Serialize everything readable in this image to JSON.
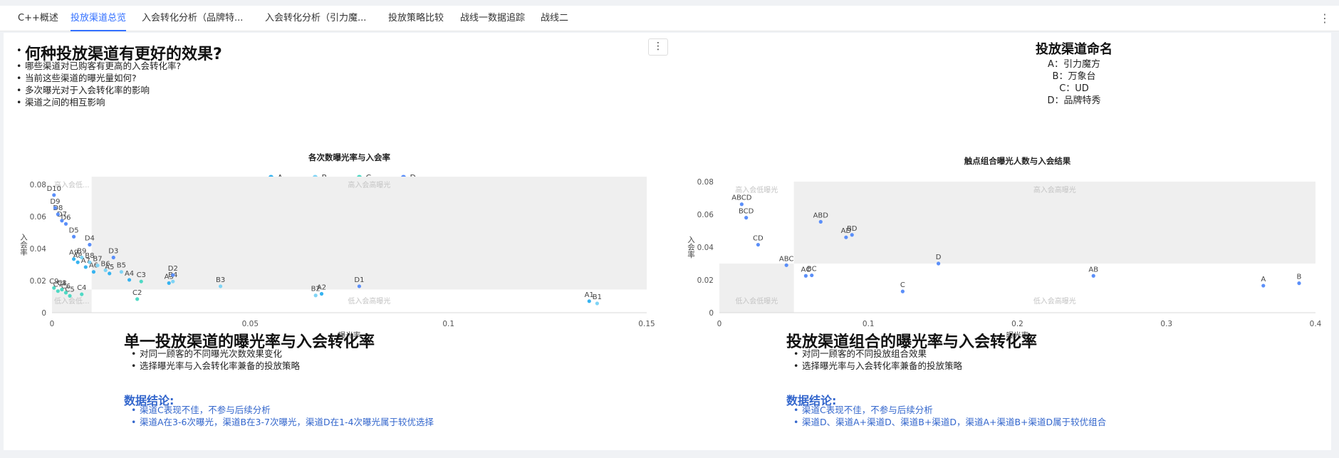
{
  "tabs": [
    {
      "label": "C++概述",
      "active": false
    },
    {
      "label": "投放渠道总览",
      "active": true
    },
    {
      "label": "入会转化分析（品牌特...",
      "active": false
    },
    {
      "label": "入会转化分析（引力魔...",
      "active": false
    },
    {
      "label": "投放策略比较",
      "active": false
    },
    {
      "label": "战线一数据追踪",
      "active": false
    },
    {
      "label": "战线二",
      "active": false
    }
  ],
  "intro": {
    "title": "何种投放渠道有更好的效果?",
    "bullets": [
      "哪些渠道对已购客有更高的入会转化率?",
      "当前这些渠道的曝光量如何?",
      "多次曝光对于入会转化率的影响",
      "渠道之间的相互影响"
    ]
  },
  "naming": {
    "title": "投放渠道命名",
    "lines": [
      "A：引力魔方",
      "B：万象台",
      "C：UD",
      "D：品牌特秀"
    ]
  },
  "left_section": {
    "title": "单一投放渠道的曝光率与入会转化率",
    "bullets": [
      "对同一顾客的不同曝光次数效果变化",
      "选择曝光率与入会转化率兼备的投放策略"
    ],
    "conclusion_title": "数据结论:",
    "conclusions": [
      "渠道C表现不佳，不参与后续分析",
      "渠道A在3-6次曝光，渠道B在3-7次曝光，渠道D在1-4次曝光属于较优选择"
    ]
  },
  "right_section": {
    "title": "投放渠道组合的曝光率与入会转化率",
    "bullets": [
      "对同一顾客的不同投放组合效果",
      "选择曝光率与入会转化率兼备的投放策略"
    ],
    "conclusion_title": "数据结论:",
    "conclusions": [
      "渠道C表现不佳，不参与后续分析",
      "渠道D、渠道A+渠道D、渠道B+渠道D，渠道A+渠道B+渠道D属于较优组合"
    ]
  },
  "colors": {
    "A": "#36b3f0",
    "B": "#7fd4f5",
    "C": "#4fd9c4",
    "D": "#5b8ff9",
    "accent": "#3370ff"
  },
  "chart_data": [
    {
      "type": "scatter",
      "title": "各次数曝光率与入会率",
      "xlabel": "曝光率",
      "ylabel": "入会率",
      "xlim": [
        0,
        0.15
      ],
      "ylim": [
        0,
        0.085
      ],
      "xticks": [
        0,
        0.05,
        0.1,
        0.15
      ],
      "xtick_labels": [
        "0",
        "0.05",
        "0.1",
        "0.15"
      ],
      "yticks": [
        0,
        0.02,
        0.04,
        0.06,
        0.08
      ],
      "ytick_labels": [
        "0",
        "0.02",
        "0.04",
        "0.06",
        "0.08"
      ],
      "legend": [
        "A",
        "B",
        "C",
        "D"
      ],
      "legend_position": "top-center",
      "quadrant": {
        "x_split": 0.01,
        "y_split": 0.0145,
        "labels": {
          "high_low": "高入会低...",
          "high_high": "高入会高曝光",
          "low_low": "低入会低...",
          "low_high": "低入会高曝光"
        }
      },
      "series": [
        {
          "name": "A",
          "points": [
            {
              "label": "A1",
              "x": 0.1355,
              "y": 0.0072
            },
            {
              "label": "A2",
              "x": 0.068,
              "y": 0.0118
            },
            {
              "label": "A3",
              "x": 0.0295,
              "y": 0.0185
            },
            {
              "label": "A4",
              "x": 0.0195,
              "y": 0.0205
            },
            {
              "label": "A5",
              "x": 0.0145,
              "y": 0.0245
            },
            {
              "label": "A6",
              "x": 0.0105,
              "y": 0.0255
            },
            {
              "label": "A7",
              "x": 0.0085,
              "y": 0.0285
            },
            {
              "label": "A8",
              "x": 0.0065,
              "y": 0.0315
            },
            {
              "label": "A9",
              "x": 0.0055,
              "y": 0.0335
            }
          ]
        },
        {
          "name": "B",
          "points": [
            {
              "label": "B1",
              "x": 0.1375,
              "y": 0.0058
            },
            {
              "label": "B2",
              "x": 0.0665,
              "y": 0.0108
            },
            {
              "label": "B3",
              "x": 0.0425,
              "y": 0.0165
            },
            {
              "label": "B4",
              "x": 0.0305,
              "y": 0.0195
            },
            {
              "label": "B5",
              "x": 0.0175,
              "y": 0.0255
            },
            {
              "label": "B6",
              "x": 0.0135,
              "y": 0.0265
            },
            {
              "label": "B7",
              "x": 0.0115,
              "y": 0.0295
            },
            {
              "label": "B8",
              "x": 0.0095,
              "y": 0.0315
            },
            {
              "label": "B9",
              "x": 0.0075,
              "y": 0.0345
            }
          ]
        },
        {
          "name": "C",
          "points": [
            {
              "label": "C1",
              "x": 0.0025,
              "y": 0.0145
            },
            {
              "label": "C2",
              "x": 0.0215,
              "y": 0.0085
            },
            {
              "label": "C3",
              "x": 0.0225,
              "y": 0.0195
            },
            {
              "label": "C4",
              "x": 0.0075,
              "y": 0.0115
            },
            {
              "label": "C5",
              "x": 0.0045,
              "y": 0.0105
            },
            {
              "label": "C6",
              "x": 0.0035,
              "y": 0.0125
            },
            {
              "label": "C7",
              "x": 0.0015,
              "y": 0.0135
            },
            {
              "label": "C8",
              "x": 0.0025,
              "y": 0.0145
            },
            {
              "label": "C9",
              "x": 0.0005,
              "y": 0.0155
            }
          ]
        },
        {
          "name": "D",
          "points": [
            {
              "label": "D1",
              "x": 0.0775,
              "y": 0.0165
            },
            {
              "label": "D2",
              "x": 0.0305,
              "y": 0.0235
            },
            {
              "label": "D3",
              "x": 0.0155,
              "y": 0.0345
            },
            {
              "label": "D4",
              "x": 0.0095,
              "y": 0.0425
            },
            {
              "label": "D5",
              "x": 0.0055,
              "y": 0.0475
            },
            {
              "label": "D6",
              "x": 0.0035,
              "y": 0.0555
            },
            {
              "label": "D7",
              "x": 0.0025,
              "y": 0.0575
            },
            {
              "label": "D8",
              "x": 0.0015,
              "y": 0.0615
            },
            {
              "label": "D9",
              "x": 0.0008,
              "y": 0.0655
            },
            {
              "label": "D10",
              "x": 0.0005,
              "y": 0.0735
            }
          ]
        }
      ]
    },
    {
      "type": "scatter",
      "title": "触点组合曝光人数与入会结果",
      "xlabel": "曝光率",
      "ylabel": "入会率",
      "xlim": [
        0,
        0.4
      ],
      "ylim": [
        0,
        0.08
      ],
      "xticks": [
        0,
        0.1,
        0.2,
        0.3,
        0.4
      ],
      "xtick_labels": [
        "0",
        "0.1",
        "0.2",
        "0.3",
        "0.4"
      ],
      "yticks": [
        0,
        0.02,
        0.04,
        0.06,
        0.08
      ],
      "ytick_labels": [
        "0",
        "0.02",
        "0.04",
        "0.06",
        "0.08"
      ],
      "quadrant": {
        "x_split": 0.05,
        "y_split": 0.03,
        "labels": {
          "high_low": "高入会低曝光",
          "high_high": "高入会高曝光",
          "low_low": "低入会低曝光",
          "low_high": "低入会高曝光"
        }
      },
      "series": [
        {
          "name": "combo",
          "points": [
            {
              "label": "ABCD",
              "x": 0.015,
              "y": 0.0662
            },
            {
              "label": "BCD",
              "x": 0.018,
              "y": 0.058
            },
            {
              "label": "ABD",
              "x": 0.068,
              "y": 0.0555
            },
            {
              "label": "AD",
              "x": 0.085,
              "y": 0.046
            },
            {
              "label": "BD",
              "x": 0.089,
              "y": 0.0475
            },
            {
              "label": "CD",
              "x": 0.026,
              "y": 0.0415
            },
            {
              "label": "ABC",
              "x": 0.045,
              "y": 0.029
            },
            {
              "label": "D",
              "x": 0.147,
              "y": 0.03
            },
            {
              "label": "BC",
              "x": 0.062,
              "y": 0.0228
            },
            {
              "label": "AC",
              "x": 0.058,
              "y": 0.0225
            },
            {
              "label": "C",
              "x": 0.123,
              "y": 0.013
            },
            {
              "label": "AB",
              "x": 0.251,
              "y": 0.0225
            },
            {
              "label": "A",
              "x": 0.365,
              "y": 0.0165
            },
            {
              "label": "B",
              "x": 0.389,
              "y": 0.018
            }
          ]
        }
      ]
    }
  ]
}
